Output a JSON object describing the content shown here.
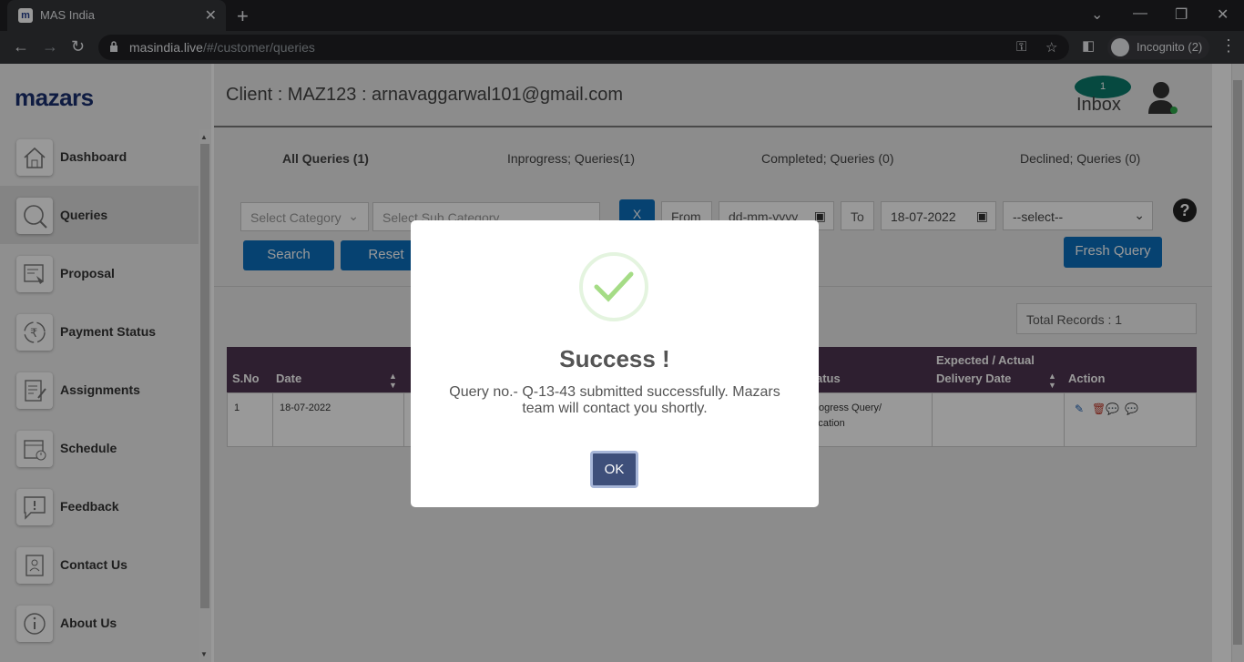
{
  "browser": {
    "tab_title": "MAS India",
    "tab_favicon": "m",
    "url_host": "masindia.live",
    "url_path": "/#/customer/queries",
    "incognito_label": "Incognito (2)"
  },
  "sidebar": {
    "logo": "mazars",
    "items": [
      {
        "label": "Dashboard",
        "icon": "home-icon"
      },
      {
        "label": "Queries",
        "icon": "search-icon"
      },
      {
        "label": "Proposal",
        "icon": "proposal-icon"
      },
      {
        "label": "Payment Status",
        "icon": "rupee-cycle-icon"
      },
      {
        "label": "Assignments",
        "icon": "assignment-icon"
      },
      {
        "label": "Schedule",
        "icon": "calendar-icon"
      },
      {
        "label": "Feedback",
        "icon": "feedback-icon"
      },
      {
        "label": "Contact Us",
        "icon": "contact-book-icon"
      },
      {
        "label": "About Us",
        "icon": "info-icon"
      }
    ]
  },
  "header": {
    "client": "Client : MAZ123 : arnavaggarwal101@gmail.com",
    "inbox_count": "1",
    "inbox_label": "Inbox"
  },
  "tabs": [
    "All Queries (1)",
    "Inprogress; Queries(1)",
    "Completed; Queries (0)",
    "Declined; Queries (0)"
  ],
  "filters": {
    "category_placeholder": "Select Category",
    "subcategory_placeholder": "Select Sub Category",
    "clear_label": "X",
    "from_label": "From",
    "from_value": "dd-mm-yyyy",
    "to_label": "To",
    "to_value": "18-07-2022",
    "status_select": "--select--",
    "search_label": "Search",
    "reset_label": "Reset",
    "fresh_query_label": "Fresh Query"
  },
  "total_records": "Total Records : 1",
  "table": {
    "headers": [
      "S.No",
      "Date",
      "Status",
      "Expected / Actual",
      "Delivery Date",
      "Action"
    ],
    "row": {
      "sno": "1",
      "date": "18-07-2022",
      "status_line1": "Inprogress Query/",
      "status_line2": "Allocation"
    }
  },
  "modal": {
    "title": "Success !",
    "message": "Query no.- Q-13-43 submitted successfully. Mazars team will contact you shortly.",
    "ok_label": "OK"
  },
  "colors": {
    "brand_blue": "#0a6ebd",
    "table_header": "#4d3450",
    "success_green": "#a5dc86"
  }
}
